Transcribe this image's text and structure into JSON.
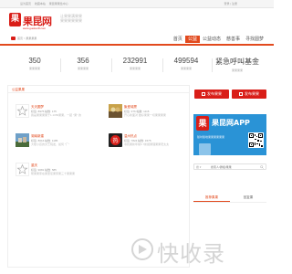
{
  "topbar": {
    "links": [
      "设为首页",
      "收藏本站",
      "果昆果果给中心"
    ],
    "right": "登录 | 注册"
  },
  "logo": {
    "badge": "果",
    "name": "果昆网",
    "url": "www.guokun8.com"
  },
  "slogan": [
    "让果果满果果",
    "果果果果果果"
  ],
  "nav": {
    "breadcrumb": "首页 > 果果果果",
    "items": [
      {
        "label": "首页",
        "active": false
      },
      {
        "label": "公益",
        "active": true
      },
      {
        "label": "公益动态",
        "active": false
      },
      {
        "label": "慈善事",
        "active": false
      },
      {
        "label": "寻找圆梦",
        "active": false
      }
    ]
  },
  "stats": [
    {
      "num": "350",
      "label": "果果果果"
    },
    {
      "num": "356",
      "label": "果果果果"
    },
    {
      "num": "232991",
      "label": "果果果果"
    },
    {
      "num": "499594",
      "label": "果果果果"
    },
    {
      "num": "紧急呼叫基金",
      "label": "果果果果"
    }
  ],
  "leftpanel": {
    "title": "公益果果",
    "cards": [
      {
        "title": "天天圆梦",
        "meta": "标签: 8975 帖数: 175",
        "desc": "我是果果果果于1.1089果果，一起 \"果\" 的",
        "thumb": "star"
      },
      {
        "title": "聚爱城厦",
        "meta": "标签: 376 帖数: 1115",
        "desc": "开心新面对 做好果果一切果果果果",
        "thumb": "photo"
      },
      {
        "title": "湖南新建",
        "meta": "标签: 8016 帖数: 1185",
        "desc": "大楼小孩的文艺院发，如何 \"厂\"",
        "thumb": "photo"
      },
      {
        "title": "温州热点",
        "meta": "标签: 7824 帖数: 1575",
        "desc": "寻找果新年前6 7新报果理果果老太太",
        "thumb": "hot"
      },
      {
        "title": "重庆",
        "meta": "标签: 9081 帖数: 585",
        "desc": "帮果果家在果里尼果家果三十果果果",
        "thumb": "star"
      }
    ]
  },
  "right": {
    "btn_left": "发布果果",
    "btn_right": "发布果果",
    "app_badge": "果",
    "app_title": "果昆网APP",
    "app_sub": "随时随地果果果果果果",
    "search_label": "搜 ▾",
    "search_placeholder": "搜索人/群组/果果",
    "tabs": [
      {
        "label": "推荐果果",
        "active": true
      },
      {
        "label": "回复果",
        "active": false
      }
    ]
  },
  "watermark": "快收录",
  "colors": {
    "brand_red": "#d91e18",
    "accent_orange": "#e24a1e",
    "app_blue": "#2a93d6"
  }
}
